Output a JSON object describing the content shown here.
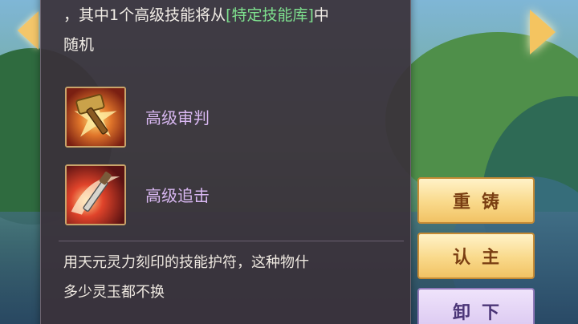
{
  "nav": {
    "prev_icon": "chevron-left-icon",
    "next_icon": "chevron-right-icon"
  },
  "panel": {
    "intro_line1": "，其中1个高级技能将从",
    "intro_highlight": "[特定技能库]",
    "intro_line1_end": "中",
    "intro_line2": "随机",
    "skills": [
      {
        "name": "高级审判",
        "icon": "hammer-skill-icon"
      },
      {
        "name": "高级追击",
        "icon": "slash-skill-icon"
      }
    ],
    "item_desc_line1": "用天元灵力刻印的技能护符，这种物什",
    "item_desc_line2": "多少灵玉都不换"
  },
  "actions": {
    "recast": "重铸",
    "bind_owner": "认主",
    "unequip": "卸下"
  },
  "colors": {
    "highlight": "#7ee08e",
    "skill_name": "#d9b8f2",
    "gold_button": "#f9d98a",
    "lilac_button": "#d9c6f0"
  }
}
